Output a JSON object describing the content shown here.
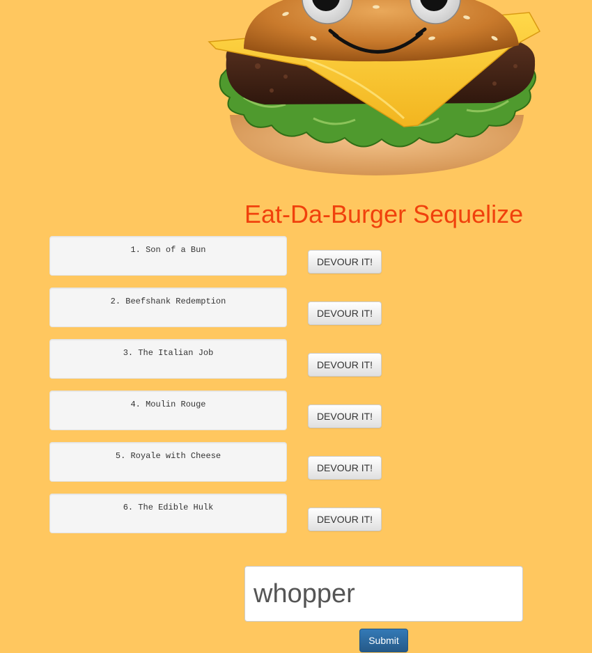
{
  "page": {
    "background_color": "#ffc75f",
    "title": "Eat-Da-Burger Sequelize",
    "title_color": "#f0410c"
  },
  "hero": {
    "image": "cartoon-burger-with-googly-eyes"
  },
  "burgers": [
    {
      "label": "1. Son of a Bun",
      "button": "DEVOUR IT!"
    },
    {
      "label": "2. Beefshank Redemption",
      "button": "DEVOUR IT!"
    },
    {
      "label": "3. The Italian Job",
      "button": "DEVOUR IT!"
    },
    {
      "label": "4. Moulin Rouge",
      "button": "DEVOUR IT!"
    },
    {
      "label": "5. Royale with Cheese",
      "button": "DEVOUR IT!"
    },
    {
      "label": "6. The Edible Hulk",
      "button": "DEVOUR IT!"
    }
  ],
  "form": {
    "input_value": "whopper",
    "submit_label": "Submit",
    "submit_color": "#337ab7"
  }
}
